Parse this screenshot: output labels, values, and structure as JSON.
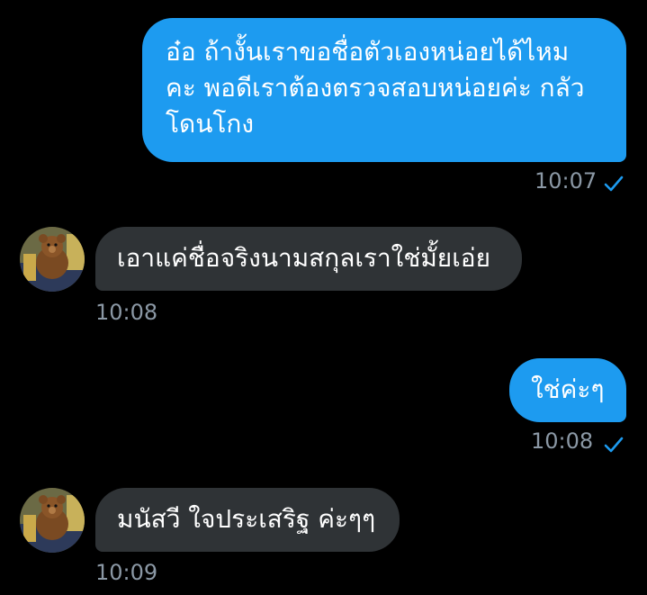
{
  "messages": [
    {
      "direction": "outgoing",
      "text_lines": [
        "อ๋อ ถ้างั้นเราขอชื่อตัวเองหน่อยได้ไหม",
        "คะ พอดีเราต้องตรวจสอบหน่อยค่ะ กลัว",
        "โดนโกง"
      ],
      "time": "10:07",
      "read_icon": "checkmark-icon"
    },
    {
      "direction": "incoming",
      "text": "เอาแค่ชื่อจริงนามสกุลเราใช่มั้ยเอ่ย",
      "time": "10:08",
      "avatar_icon": "teddy-bear-avatar"
    },
    {
      "direction": "outgoing",
      "text": "ใช่ค่ะๆ",
      "time": "10:08",
      "read_icon": "checkmark-icon"
    },
    {
      "direction": "incoming",
      "text": "มนัสวี ใจประเสริฐ ค่ะๆๆ",
      "time": "10:09",
      "avatar_icon": "teddy-bear-avatar"
    }
  ],
  "colors": {
    "background": "#000000",
    "outgoing_bubble": "#1d9bf0",
    "incoming_bubble": "#2f3336",
    "timestamp": "#8b98a5",
    "checkmark": "#1d9bf0"
  }
}
